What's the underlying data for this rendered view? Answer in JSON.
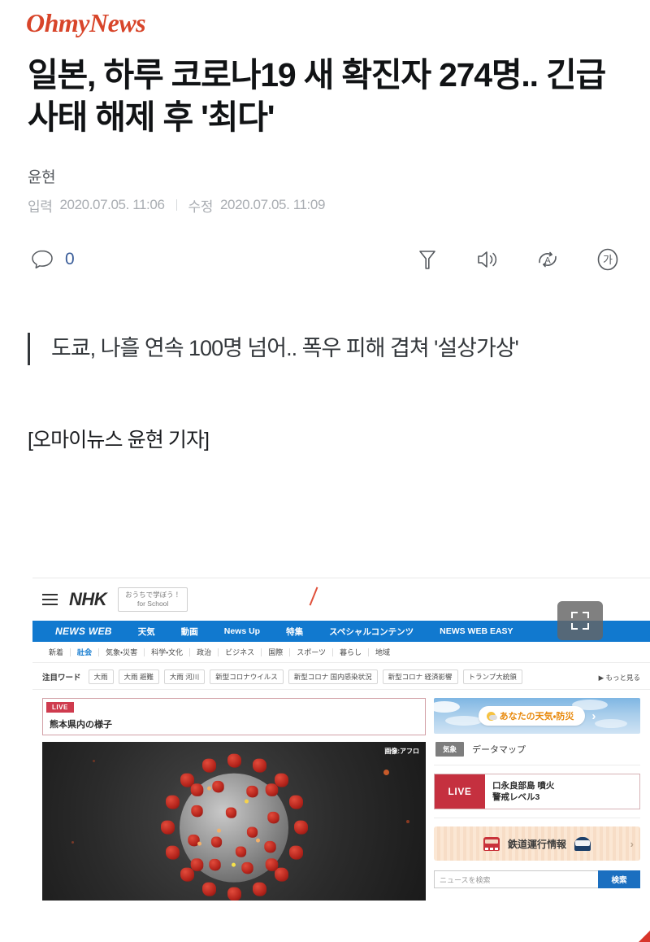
{
  "site": {
    "brand": "OhmyNews"
  },
  "article": {
    "headline": "일본, 하루 코로나19 새 확진자 274명.. 긴급사태 해제 후 '최다'",
    "author": "윤현",
    "published_label": "입력",
    "published_at": "2020.07.05. 11:06",
    "updated_label": "수정",
    "updated_at": "2020.07.05. 11:09",
    "subheading": "도쿄, 나흘 연속 100명 넘어.. 폭우 피해 겹쳐 '설상가상'",
    "lead": "[오마이뉴스 윤현 기자]"
  },
  "toolbar": {
    "comment_icon": "comment-bubble-icon",
    "comment_count": "0",
    "filter_icon": "funnel-icon",
    "tts_icon": "speaker-icon",
    "translate_icon": "auto-translate-icon",
    "fontsize_icon": "font-size-icon",
    "fontsize_glyph": "가"
  },
  "embed": {
    "fullscreen_icon": "fullscreen-expand-icon",
    "nhk": {
      "menu_icon": "hamburger-menu-icon",
      "logo": "NHK",
      "school_button_line1": "おうちで学ぼう！",
      "school_button_line2": "for School",
      "nav": [
        "NEWS WEB",
        "天気",
        "動画",
        "News Up",
        "特集",
        "スペシャルコンテンツ",
        "NEWS WEB EASY"
      ],
      "subnav": [
        {
          "label": "新着",
          "active": false
        },
        {
          "label": "社会",
          "active": true
        },
        {
          "label": "気象・災害",
          "active": false
        },
        {
          "label": "科学・文化",
          "active": false
        },
        {
          "label": "政治",
          "active": false
        },
        {
          "label": "ビジネス",
          "active": false
        },
        {
          "label": "国際",
          "active": false
        },
        {
          "label": "スポーツ",
          "active": false
        },
        {
          "label": "暮らし",
          "active": false
        },
        {
          "label": "地域",
          "active": false
        }
      ],
      "keywords_label": "注目ワード",
      "keywords": [
        "大雨",
        "大雨 避難",
        "大雨 河川",
        "新型コロナウイルス",
        "新型コロナ 国内感染状況",
        "新型コロナ 経済影響",
        "トランプ大統領"
      ],
      "keywords_more": "▶ もっと見る",
      "live_banner": {
        "tag": "LIVE",
        "title": "熊本県内の様子"
      },
      "photo_credit": "画像:アフロ",
      "sidebar": {
        "weather_banner": {
          "text": "あなたの天気・防災",
          "chevron": "›",
          "sun_icon": "sun-cloud-icon"
        },
        "data_map": {
          "badge": "気象",
          "text": "データマップ"
        },
        "volcano_live": {
          "tag": "LIVE",
          "line1": "口永良部島 噴火",
          "line2": "警戒レベル3"
        },
        "rail_banner": {
          "text": "鉄道運行情報",
          "train_icon": "train-icon",
          "shinkansen_icon": "shinkansen-icon",
          "chevron": "›"
        },
        "search": {
          "placeholder": "ニュースを検索",
          "button": "検索"
        }
      }
    }
  },
  "colors": {
    "brand_red": "#d8452a",
    "nhk_blue": "#1179cf",
    "live_red": "#cf3b4e",
    "comment_blue": "#3a5d99"
  }
}
